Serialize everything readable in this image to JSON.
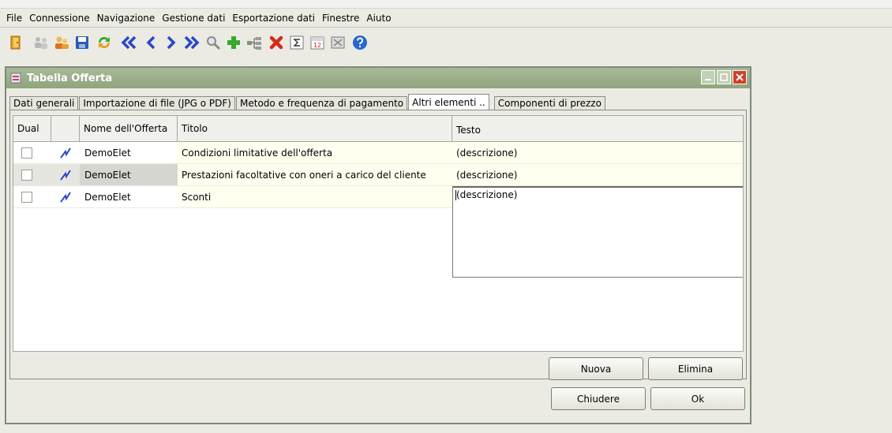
{
  "menu": [
    "File",
    "Connessione",
    "Navigazione",
    "Gestione dati",
    "Esportazione dati",
    "Finestre",
    "Aiuto"
  ],
  "toolbar_icons": [
    "exit-icon",
    "people-icon",
    "users-icon",
    "save-icon",
    "refresh-icon",
    "first-record-icon",
    "previous-record-icon",
    "next-record-icon",
    "last-record-icon",
    "search-icon",
    "add-icon",
    "tree-icon",
    "delete-icon",
    "sum-icon",
    "calendar-icon",
    "export-icon",
    "help-icon"
  ],
  "colors": {
    "titlebar": "#96aa86",
    "close": "#d03e2a",
    "row_highlight": "#fffff0"
  },
  "window": {
    "title": "Tabella Offerta"
  },
  "calendar_day": "12",
  "tabs": [
    "Dati generali",
    "Importazione di file (JPG o PDF)",
    "Metodo e frequenza di pagamento",
    "Altri elementi ..",
    "Componenti di prezzo"
  ],
  "active_tab": 3,
  "table": {
    "headers": [
      "Dual",
      "",
      "Nome dell'Offerta",
      "Titolo",
      "Testo"
    ],
    "rows": [
      {
        "nome": "DemoElet",
        "titolo": "Condizioni limitative dell'offerta",
        "testo": "(descrizione)"
      },
      {
        "nome": "DemoElet",
        "titolo": "Prestazioni facoltative con oneri a carico del cliente",
        "testo": "(descrizione)"
      },
      {
        "nome": "DemoElet",
        "titolo": "Sconti",
        "testo": "(descrizione)"
      }
    ]
  },
  "buttons": {
    "nuova": "Nuova",
    "elimina": "Elimina",
    "chiudere": "Chiudere",
    "ok": "Ok"
  }
}
